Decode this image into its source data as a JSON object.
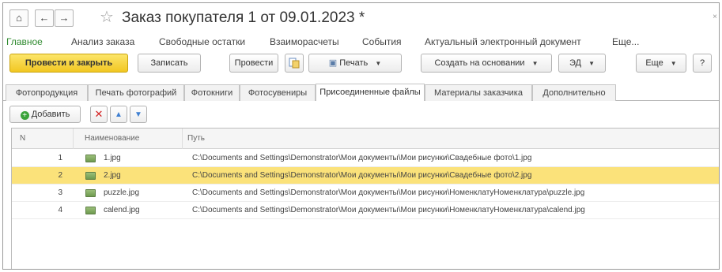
{
  "title": "Заказ покупателя 1 от 09.01.2023 *",
  "nav": {
    "home": "⌂",
    "back": "←",
    "forward": "→",
    "star": "☆",
    "close": "×"
  },
  "sections": [
    "Главное",
    "Анализ заказа",
    "Свободные остатки",
    "Взаиморасчеты",
    "События",
    "Актуальный электронный документ",
    "Еще..."
  ],
  "toolbar": {
    "post_close": "Провести и закрыть",
    "write": "Записать",
    "post": "Провести",
    "print": "Печать",
    "create_based": "Создать на основании",
    "edo": "ЭД",
    "more": "Еще",
    "help": "?"
  },
  "tabs": [
    "Фотопродукция",
    "Печать фотографий",
    "Фотокниги",
    "Фотосувениры",
    "Присоединенные файлы",
    "Материалы заказчика",
    "Дополнительно"
  ],
  "active_tab_index": 4,
  "list_toolbar": {
    "add": "Добавить"
  },
  "table": {
    "columns": [
      "N",
      "Наименование",
      "Путь"
    ],
    "rows": [
      {
        "n": "1",
        "name": "1.jpg",
        "path": "C:\\Documents and Settings\\Demonstrator\\Мои документы\\Мои рисунки\\Свадебные фото\\1.jpg",
        "selected": false
      },
      {
        "n": "2",
        "name": "2.jpg",
        "path": "C:\\Documents and Settings\\Demonstrator\\Мои документы\\Мои рисунки\\Свадебные фото\\2.jpg",
        "selected": true
      },
      {
        "n": "3",
        "name": "puzzle.jpg",
        "path": "C:\\Documents and Settings\\Demonstrator\\Мои документы\\Мои рисунки\\НоменклатуНоменклатура\\puzzle.jpg",
        "selected": false
      },
      {
        "n": "4",
        "name": "calend.jpg",
        "path": "C:\\Documents and Settings\\Demonstrator\\Мои документы\\Мои рисунки\\НоменклатуНоменклатура\\calend.jpg",
        "selected": false
      }
    ]
  },
  "colors": {
    "accent_green": "#2f8a2f",
    "primary_button": "#f2c722",
    "selected_row": "#fbe27a"
  }
}
